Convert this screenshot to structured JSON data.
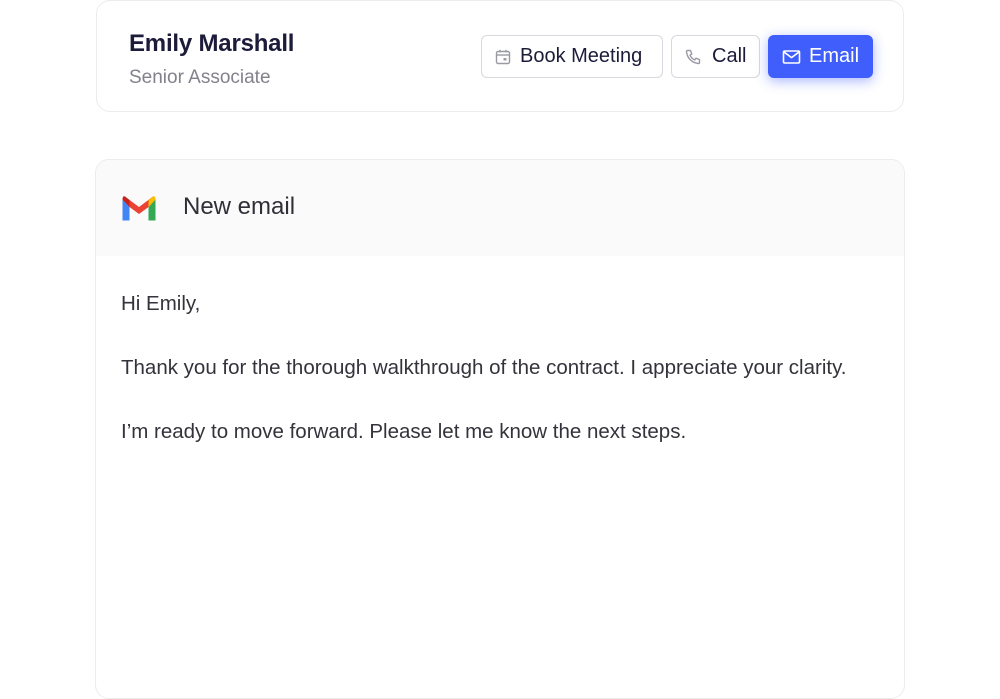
{
  "contact": {
    "name": "Emily Marshall",
    "role": "Senior Associate"
  },
  "actions": {
    "book_meeting": "Book Meeting",
    "call": "Call",
    "email": "Email"
  },
  "icons": {
    "book_meeting": "calendar-icon",
    "call": "phone-icon",
    "email": "mail-icon",
    "composer": "gmail-logo"
  },
  "colors": {
    "accent": "#3f5efb",
    "name_text": "#1c1b3a",
    "muted_text": "#82828c"
  },
  "composer": {
    "title": "New email",
    "body": [
      "Hi Emily,",
      "Thank you for the thorough walkthrough of the contract. I appreciate your clarity.",
      "I’m ready to move forward. Please let me know the next steps."
    ]
  }
}
